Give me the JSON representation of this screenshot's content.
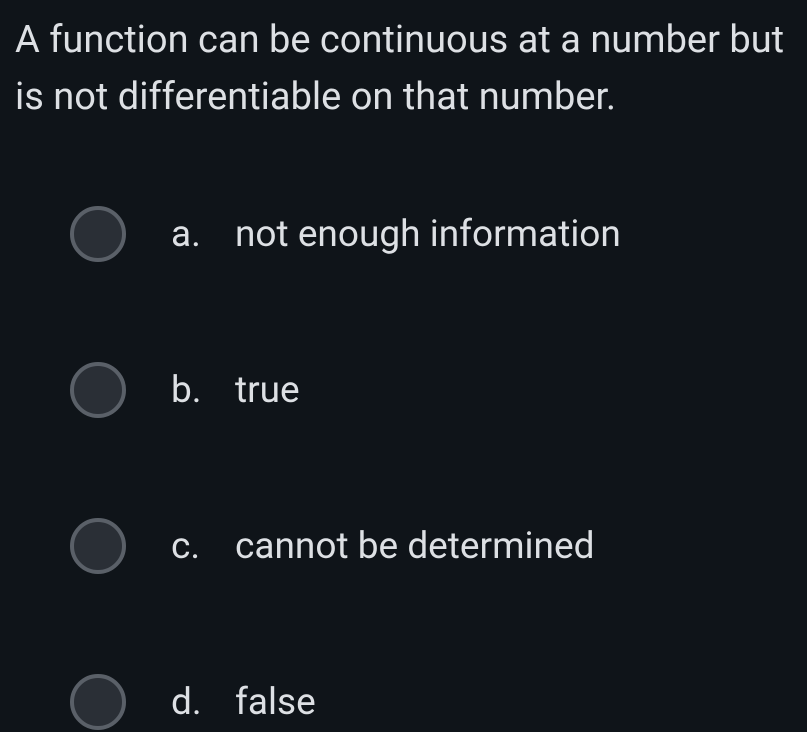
{
  "question": {
    "text": "A function can be continuous at a number but is not differentiable on that number."
  },
  "options": [
    {
      "letter": "a.",
      "text": "not enough information"
    },
    {
      "letter": "b.",
      "text": "true"
    },
    {
      "letter": "c.",
      "text": "cannot be determined"
    },
    {
      "letter": "d.",
      "text": "false"
    }
  ]
}
